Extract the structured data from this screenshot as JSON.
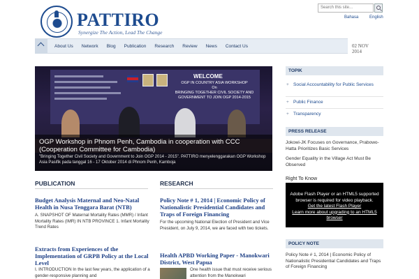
{
  "header": {
    "brand": "PATTIRO",
    "tagline": "Synergize The Action, Lead The Change",
    "search_placeholder": "Search this site...",
    "lang_bahasa": "Bahasa",
    "lang_english": "English"
  },
  "nav": {
    "items": [
      "About Us",
      "Network",
      "Blog",
      "Publication",
      "Research",
      "Review",
      "News",
      "Contact Us"
    ]
  },
  "date": {
    "day_month": "02 NOV",
    "year": "2014"
  },
  "feature": {
    "banner_welcome": "WELCOME",
    "banner_lines": [
      "OGP IN COUNTRY ASIA WORKSHOP",
      "On",
      "BRINGING TOGETHER CIVIL SOCIETY AND",
      "GOVERNMENT TO JOIN OGP 2014-2015"
    ],
    "title": "OGP Workshop in Phnom Penh, Cambodia in cooperation with CCC (Cooperation Committee for Cambodia)",
    "subtitle": "\"Bringing Together Civil Society and Government to Join OGP 2014 - 2015\". PATTIRO menyelenggarakan OGP Workshop Asia Pasifik pada tanggal 16 - 17 Oktober 2014 di Phnom Penh, Kamboja"
  },
  "sidebar": {
    "topik_header": "TOPIK",
    "topik_items": [
      "Social Accountability for Public Services",
      "Public Finance",
      "Transparency"
    ],
    "press_header": "PRESS RELEASE",
    "press_items": [
      "Jokowi-JK Focuses on Governance, Prabowo-Hatta Prioritizes Basic Services",
      "Gender Equality in the Village Act Must Be Observed"
    ],
    "rtk_label": "Right To Know",
    "flash_line1": "Adobe Flash Player or an HTML5 supported browser is required for video playback.",
    "flash_link1": "Get the latest Flash Player",
    "flash_link2": "Learn more about upgrading to an HTML5 browser",
    "policy_header": "POLICY NOTE",
    "policy_items": [
      "Policy Note # 1, 2014 | Economic Policy of Nationalistic Presidential Candidates and Traps of Foreign Financing"
    ]
  },
  "publication": {
    "header": "PUBLICATION",
    "articles": [
      {
        "title": "Budget Analysis Maternal and Neo-Natal Health in Nusa Tenggara Barat (NTB)",
        "body": "A. SNAPSHOT OF Maternal Mortality Rates (MMR) / Infant Mortality Rates (IMR) IN NTB PROVINCE 1. Infant Mortality Trend Rates"
      },
      {
        "title": "Extracts from Experiences of the Implementation of GRPB Policy at the Local Level",
        "body": "I. INTRODUCTION In the last few years, the application of a gender-responsive planning and"
      }
    ]
  },
  "research": {
    "header": "RESEARCH",
    "articles": [
      {
        "title": "Policy Note # 1, 2014 | Economic Policy of Nationalistic Presidential Candidates and Traps of Foreign Financing",
        "body": "For the upcoming National Election of President and Vice President, on July 9, 2014, we are faced with two tickets."
      },
      {
        "title": "Health APBD Working Paper - Manokwari District, West Papua",
        "body": "One health issue that must receive serious attention from the Manokwari"
      }
    ]
  }
}
